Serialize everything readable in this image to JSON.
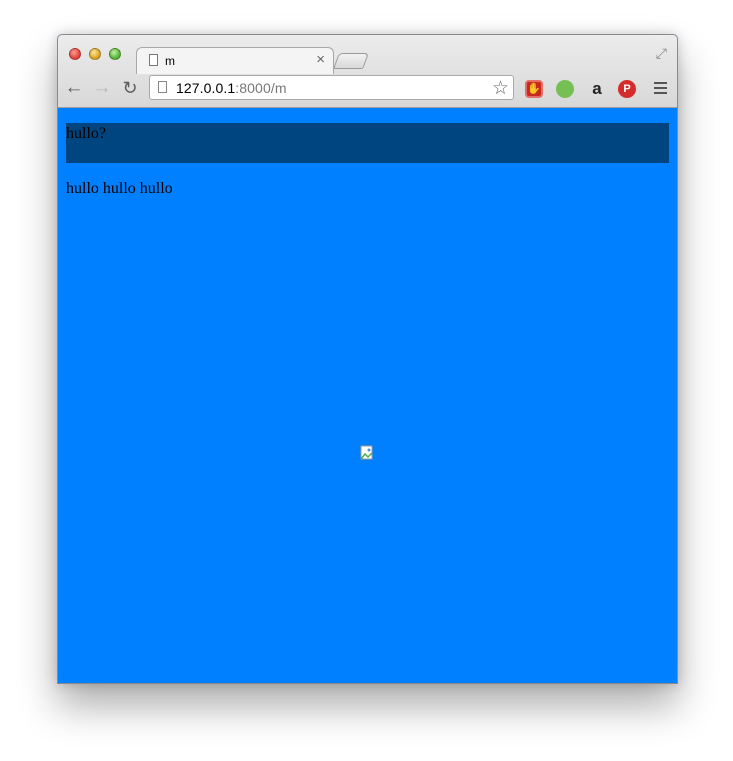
{
  "browser": {
    "tab": {
      "title": "m",
      "close_symbol": "×"
    },
    "omnibox": {
      "url_host": "127.0.0.1",
      "url_rest": ":8000/m"
    },
    "toolbar": {
      "back_glyph": "←",
      "forward_glyph": "→",
      "reload_glyph": "↻",
      "star_glyph": "☆"
    },
    "extensions": [
      {
        "name": "adblock-icon",
        "glyph": "✋"
      },
      {
        "name": "evernote-icon",
        "glyph": ""
      },
      {
        "name": "amazon-icon",
        "glyph": "a"
      },
      {
        "name": "pinterest-icon",
        "glyph": "P"
      }
    ],
    "fullscreen_glyph": "⤢"
  },
  "page": {
    "background": "#0080ff",
    "header_box_color": "#00457f",
    "header_text": "hullo?",
    "paragraph_text": "hullo hullo hullo"
  }
}
